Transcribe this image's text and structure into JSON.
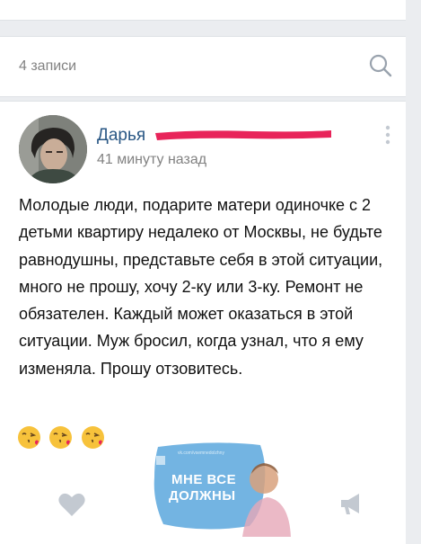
{
  "wall": {
    "count_label": "4 записи"
  },
  "post": {
    "author": "Дарья",
    "time": "41 минуту назад",
    "text": "Молодые люди, подарите матери одиночке с 2 детьми квартиру недалеко от Москвы, не будьте равнодушны, представьте себя в этой ситуации, много не прошу, хочу 2-ку или 3-ку. Ремонт не обязателен. Каждый может оказаться в этой ситуации. Муж бросил, когда узнал, что я ему изменяла. Прошу отзовитесь.",
    "emojis": [
      "face-blowing-kiss-emoji",
      "face-blowing-kiss-emoji",
      "face-blowing-kiss-emoji"
    ]
  },
  "watermark": {
    "line1": "МНЕ ВСЕ",
    "line2": "ДОЛЖНЫ",
    "tiny": "vk.com/vsemnedolzhny"
  },
  "colors": {
    "background": "#ebedf0",
    "card": "#ffffff",
    "link": "#2a5885",
    "secondary_text": "#828282",
    "redaction": "#e8245a",
    "icon": "#c3c9d1",
    "watermark": "#5ba7dd"
  },
  "icons": {
    "search": "search-icon",
    "more": "more-vertical-icon",
    "like": "heart-icon",
    "share": "megaphone-icon"
  }
}
